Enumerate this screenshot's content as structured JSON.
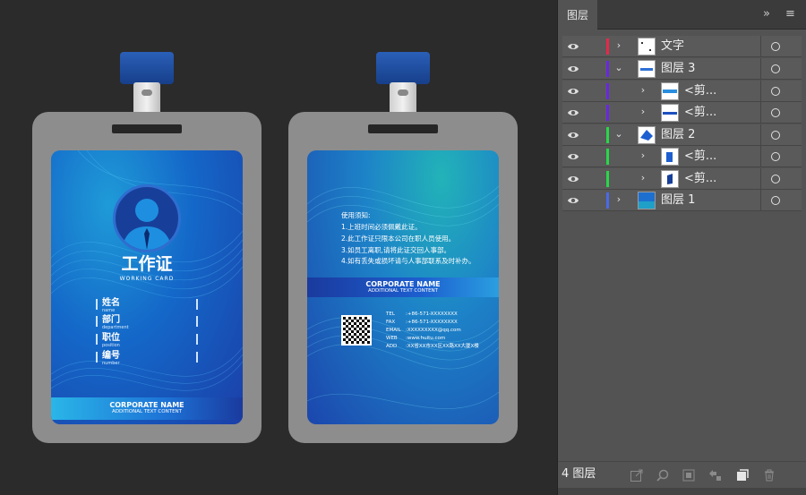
{
  "panel": {
    "tab_label": "图层",
    "layer_count": "4 图层",
    "layers": [
      {
        "name": "文字",
        "color": "#e8284a",
        "expanded": false
      },
      {
        "name": "图层 3",
        "color": "#6a28e0",
        "expanded": true
      },
      {
        "name": "<剪...",
        "color": "#6a28e0",
        "expanded": false
      },
      {
        "name": "<剪...",
        "color": "#6a28e0",
        "expanded": false
      },
      {
        "name": "图层 2",
        "color": "#28d84a",
        "expanded": true
      },
      {
        "name": "<剪...",
        "color": "#28d84a",
        "expanded": false
      },
      {
        "name": "<剪...",
        "color": "#28d84a",
        "expanded": false
      },
      {
        "name": "图层 1",
        "color": "#4a6ae8",
        "expanded": false
      }
    ],
    "footer_icons": [
      "export-icon",
      "locate-icon",
      "clipping-mask-icon",
      "sublayer-icon",
      "new-layer-icon",
      "delete-icon"
    ]
  },
  "front_card": {
    "title": "工作证",
    "subtitle": "WORKING CARD",
    "fields": [
      {
        "label": "姓名",
        "sub": "name"
      },
      {
        "label": "部门",
        "sub": "department"
      },
      {
        "label": "职位",
        "sub": "position"
      },
      {
        "label": "编号",
        "sub": "number"
      }
    ],
    "banner_title": "CORPORATE NAME",
    "banner_sub": "ADDITIONAL TEXT CONTENT"
  },
  "back_card": {
    "notice_title": "使用须知:",
    "notices": [
      "1.上班时间必须佩戴此证。",
      "2.此工作证只限本公司在职人员使用。",
      "3.如员工离职,请将此证交回人事部。",
      "4.如有丢失或损坏请与人事部联系及时补办。"
    ],
    "banner_title": "CORPORATE NAME",
    "banner_sub": "ADDITIONAL TEXT CONTENT",
    "contacts": [
      {
        "key": "TEL",
        "value": ":+86-571-XXXXXXXX"
      },
      {
        "key": "FAX",
        "value": ":+86-571-XXXXXXXX"
      },
      {
        "key": "EMAIL",
        "value": ":XXXXXXXXX@qq.com"
      },
      {
        "key": "WEB",
        "value": ":www.huitu.com"
      },
      {
        "key": "ADD",
        "value": ":XX省XX市XX区XX路XX大厦X楼"
      }
    ]
  },
  "colors": {
    "canvas_bg": "#2b2b2b",
    "panel_bg": "#535353",
    "card_blue": "#1467c8",
    "lanyard_blue": "#173f8a"
  }
}
